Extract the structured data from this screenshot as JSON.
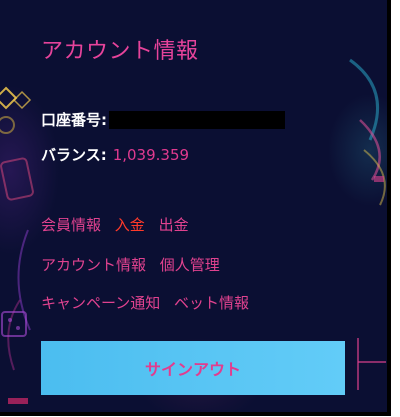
{
  "panel": {
    "title": "アカウント情報"
  },
  "account": {
    "account_label": "口座番号:",
    "balance_label": "バランス:",
    "balance_value": "1,039.359"
  },
  "menu": {
    "row1": [
      "会員情報",
      "入金",
      "出金"
    ],
    "row2": [
      "アカウント情報",
      "個人管理"
    ],
    "row3": [
      "キャンペーン通知",
      "ベット情報"
    ]
  },
  "signout": {
    "label": "サインアウト"
  },
  "colors": {
    "panel_bg": "#0b0f33",
    "accent_pink": "#e7439b",
    "accent_red": "#ff3a2a",
    "button_blue": "#52c3f3"
  }
}
